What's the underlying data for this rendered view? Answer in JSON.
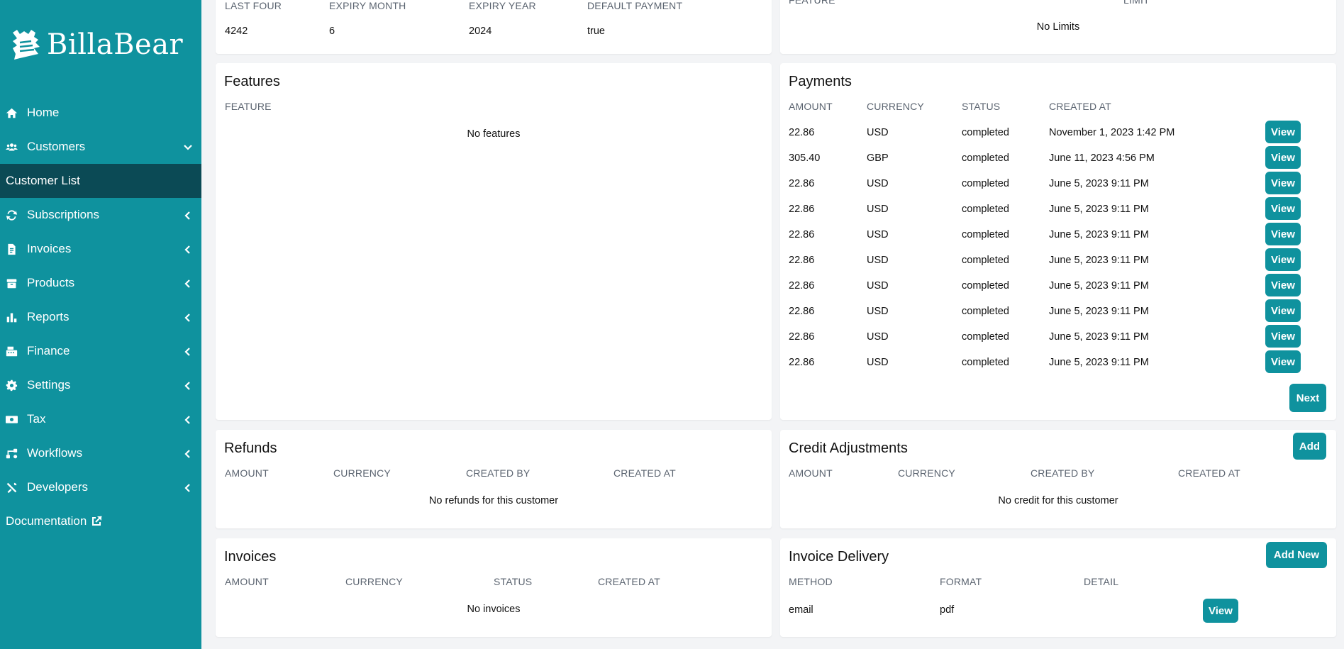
{
  "brand": {
    "name": "BillaBear"
  },
  "sidebar": {
    "items": [
      {
        "label": "Home",
        "icon": "home-icon",
        "chevron": ""
      },
      {
        "label": "Customers",
        "icon": "users-icon",
        "chevron": "down"
      },
      {
        "label": "Customer List",
        "icon": "",
        "chevron": "",
        "active": true
      },
      {
        "label": "Subscriptions",
        "icon": "repeat-icon",
        "chevron": "left"
      },
      {
        "label": "Invoices",
        "icon": "invoice-icon",
        "chevron": "left"
      },
      {
        "label": "Products",
        "icon": "box-icon",
        "chevron": "left"
      },
      {
        "label": "Reports",
        "icon": "chart-icon",
        "chevron": "left"
      },
      {
        "label": "Finance",
        "icon": "cash-register-icon",
        "chevron": "left"
      },
      {
        "label": "Settings",
        "icon": "gear-icon",
        "chevron": "left"
      },
      {
        "label": "Tax",
        "icon": "money-icon",
        "chevron": "left"
      },
      {
        "label": "Workflows",
        "icon": "workflow-icon",
        "chevron": "left"
      },
      {
        "label": "Developers",
        "icon": "tools-icon",
        "chevron": "left"
      },
      {
        "label": "Documentation",
        "icon": "external-link-icon",
        "chevron": ""
      }
    ]
  },
  "payment_methods": {
    "headers": [
      "LAST FOUR",
      "EXPIRY MONTH",
      "EXPIRY YEAR",
      "DEFAULT PAYMENT"
    ],
    "row": [
      "4242",
      "6",
      "2024",
      "true"
    ]
  },
  "limits": {
    "headers": [
      "FEATURE",
      "LIMIT"
    ],
    "empty": "No Limits"
  },
  "features": {
    "title": "Features",
    "headers": [
      "FEATURE"
    ],
    "empty": "No features"
  },
  "payments": {
    "title": "Payments",
    "headers": [
      "AMOUNT",
      "CURRENCY",
      "STATUS",
      "CREATED AT"
    ],
    "rows": [
      [
        "22.86",
        "USD",
        "completed",
        "November 1, 2023 1:42 PM"
      ],
      [
        "305.40",
        "GBP",
        "completed",
        "June 11, 2023 4:56 PM"
      ],
      [
        "22.86",
        "USD",
        "completed",
        "June 5, 2023 9:11 PM"
      ],
      [
        "22.86",
        "USD",
        "completed",
        "June 5, 2023 9:11 PM"
      ],
      [
        "22.86",
        "USD",
        "completed",
        "June 5, 2023 9:11 PM"
      ],
      [
        "22.86",
        "USD",
        "completed",
        "June 5, 2023 9:11 PM"
      ],
      [
        "22.86",
        "USD",
        "completed",
        "June 5, 2023 9:11 PM"
      ],
      [
        "22.86",
        "USD",
        "completed",
        "June 5, 2023 9:11 PM"
      ],
      [
        "22.86",
        "USD",
        "completed",
        "June 5, 2023 9:11 PM"
      ],
      [
        "22.86",
        "USD",
        "completed",
        "June 5, 2023 9:11 PM"
      ]
    ],
    "view_label": "View",
    "next_label": "Next"
  },
  "refunds": {
    "title": "Refunds",
    "headers": [
      "AMOUNT",
      "CURRENCY",
      "CREATED BY",
      "CREATED AT"
    ],
    "empty": "No refunds for this customer"
  },
  "credit_adjustments": {
    "title": "Credit Adjustments",
    "add_label": "Add",
    "headers": [
      "AMOUNT",
      "CURRENCY",
      "CREATED BY",
      "CREATED AT"
    ],
    "empty": "No credit for this customer"
  },
  "invoices": {
    "title": "Invoices",
    "headers": [
      "AMOUNT",
      "CURRENCY",
      "STATUS",
      "CREATED AT"
    ],
    "empty": "No invoices"
  },
  "invoice_delivery": {
    "title": "Invoice Delivery",
    "add_label": "Add New",
    "headers": [
      "METHOD",
      "FORMAT",
      "DETAIL"
    ],
    "row": [
      "email",
      "pdf",
      ""
    ],
    "view_label": "View"
  },
  "colors": {
    "accent": "#0f929e",
    "active_nav": "#0b4a55",
    "background": "#f3f4f6"
  }
}
